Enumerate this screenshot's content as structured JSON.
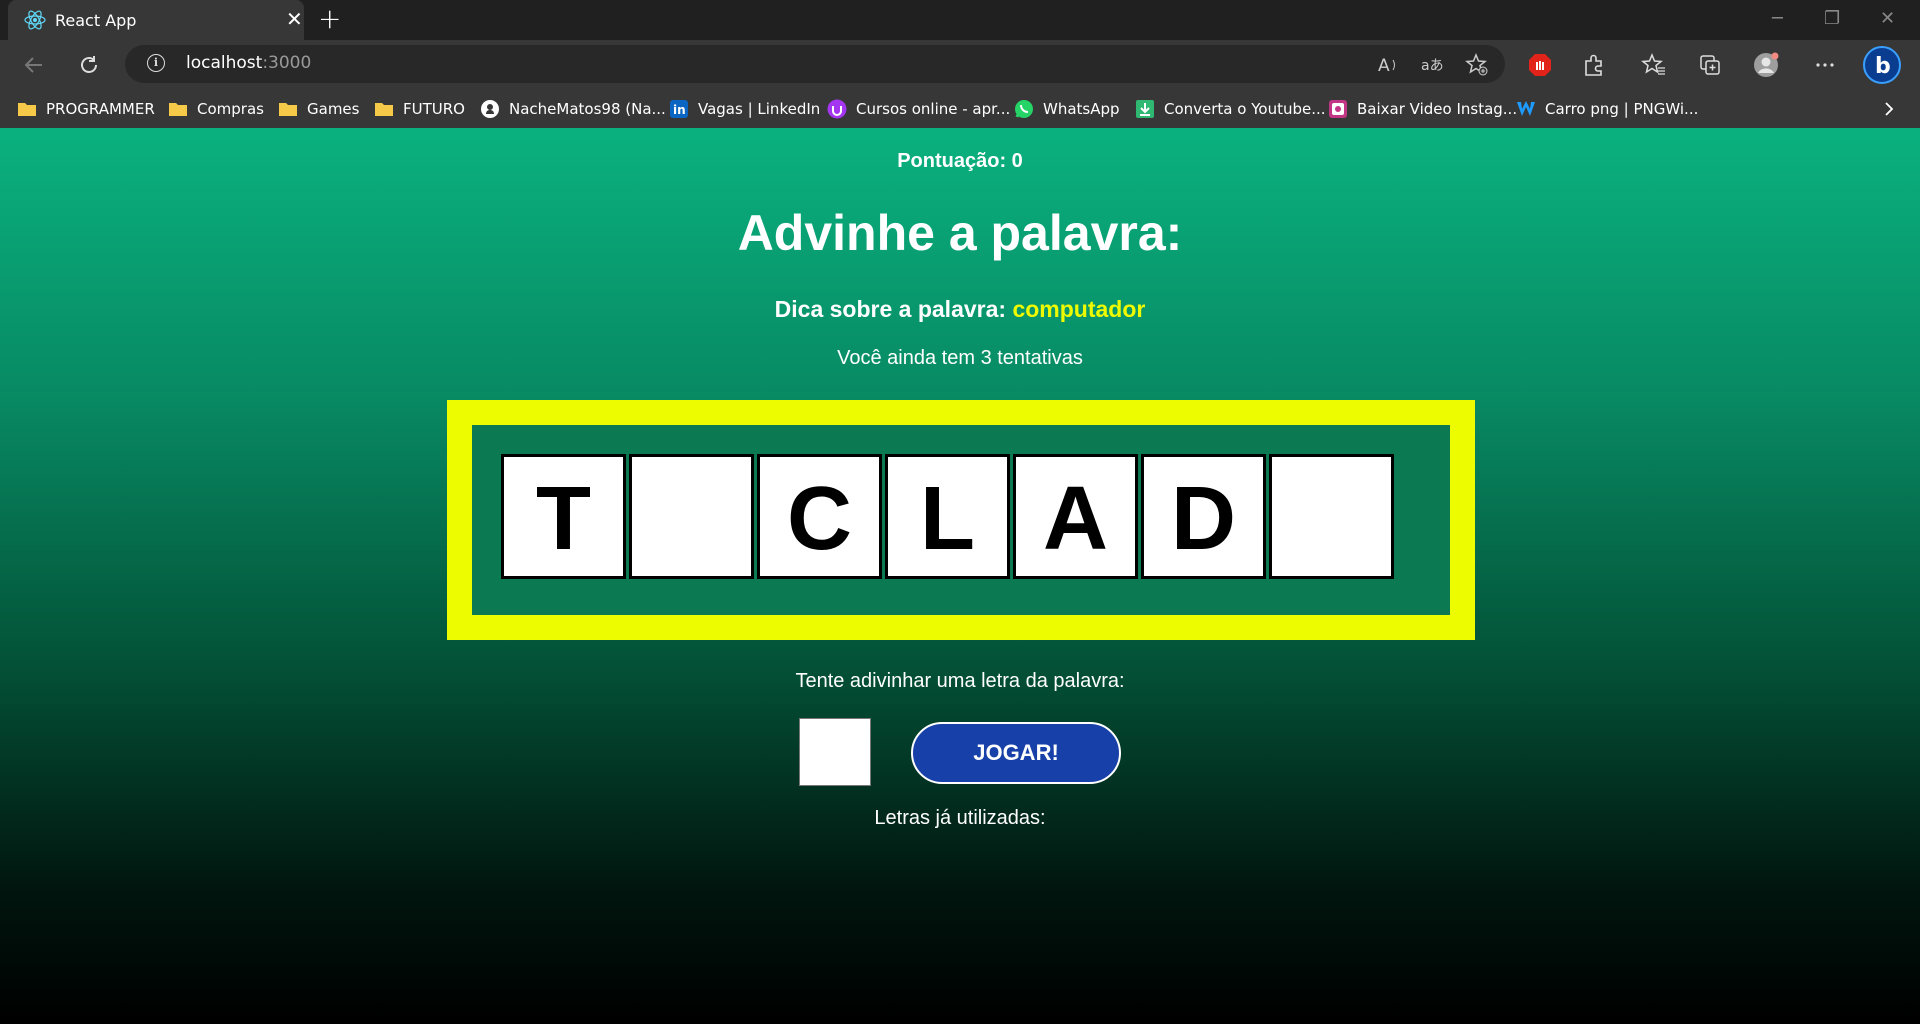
{
  "browser": {
    "tab": {
      "title": "React App",
      "favicon": "react-icon"
    },
    "address": {
      "host": "localhost",
      "port": ":3000"
    },
    "bookmarks": [
      {
        "label": "PROGRAMMER",
        "icon": "folder-icon"
      },
      {
        "label": "Compras",
        "icon": "folder-icon"
      },
      {
        "label": "Games",
        "icon": "folder-icon"
      },
      {
        "label": "FUTURO",
        "icon": "folder-icon"
      },
      {
        "label": "NacheMatos98 (Na...",
        "icon": "github-icon"
      },
      {
        "label": "Vagas | LinkedIn",
        "icon": "linkedin-icon"
      },
      {
        "label": "Cursos online - apr...",
        "icon": "udemy-icon"
      },
      {
        "label": "WhatsApp",
        "icon": "whatsapp-icon"
      },
      {
        "label": "Converta o Youtube...",
        "icon": "download-icon"
      },
      {
        "label": "Baixar Video Instag...",
        "icon": "instagram-icon"
      },
      {
        "label": "Carro png | PNGWi...",
        "icon": "pngwing-icon"
      }
    ]
  },
  "game": {
    "score_label": "Pontuação: 0",
    "heading": "Advinhe a palavra:",
    "tip_label": "Dica sobre a palavra:",
    "tip_word": "computador",
    "attempts_text": "Você ainda tem 3 tentativas",
    "letters": [
      "T",
      "",
      "C",
      "L",
      "A",
      "D",
      ""
    ],
    "guess_prompt": "Tente adivinhar uma letra da palavra:",
    "guess_value": "",
    "play_button": "JOGAR!",
    "used_letters_label": "Letras já utilizadas:"
  },
  "colors": {
    "gradient_top": "#0ab17f",
    "gradient_bottom": "#000000",
    "frame_yellow": "#eefc00",
    "tip_highlight": "#eefb00",
    "button_blue": "#1741a8"
  }
}
